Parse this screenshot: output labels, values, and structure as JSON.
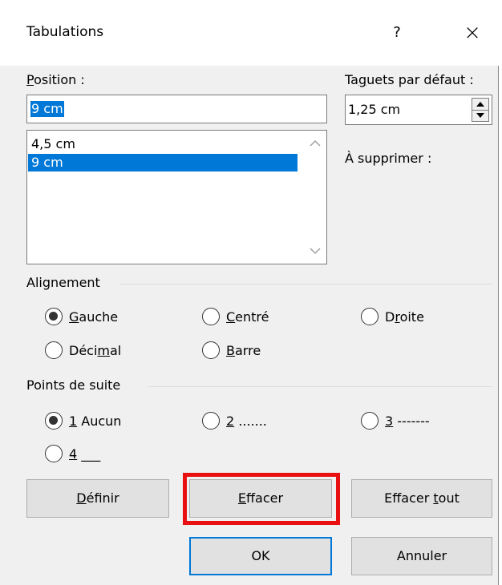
{
  "dialog": {
    "title": "Tabulations",
    "help_label": "?",
    "close_label": "×"
  },
  "position": {
    "label_ul": "P",
    "label_rest": "osition :",
    "value": "9 cm",
    "list": [
      "4,5 cm",
      "9 cm"
    ],
    "selected": "9 cm"
  },
  "default_tabs": {
    "label_a": "Ta",
    "label_ul": "g",
    "label_b": "uets par défaut :",
    "value": "1,25 cm"
  },
  "to_delete": {
    "label": "À supprimer :"
  },
  "alignment": {
    "label": "Alignement",
    "options": [
      {
        "pre": "",
        "ul": "G",
        "post": "auche",
        "checked": true
      },
      {
        "pre": "",
        "ul": "C",
        "post": "entré",
        "checked": false
      },
      {
        "pre": "D",
        "ul": "r",
        "post": "oite",
        "checked": false
      },
      {
        "pre": "Déci",
        "ul": "m",
        "post": "al",
        "checked": false
      },
      {
        "pre": "",
        "ul": "B",
        "post": "arre",
        "checked": false
      }
    ]
  },
  "leader": {
    "label": "Points de suite",
    "options": [
      {
        "ul": "1",
        "post": " Aucun",
        "checked": true
      },
      {
        "ul": "2",
        "post": " .......",
        "checked": false
      },
      {
        "ul": "3",
        "post": " -------",
        "checked": false
      },
      {
        "ul": "4",
        "post": " ___",
        "checked": false
      }
    ]
  },
  "buttons": {
    "set_ul": "D",
    "set_rest": "éfinir",
    "clear_ul": "E",
    "clear_rest": "ffacer",
    "clear_all_a": "Effacer ",
    "clear_all_ul": "t",
    "clear_all_b": "out",
    "ok": "OK",
    "cancel": "Annuler"
  },
  "colors": {
    "selection": "#0078d7",
    "highlight_box": "#e81010"
  }
}
